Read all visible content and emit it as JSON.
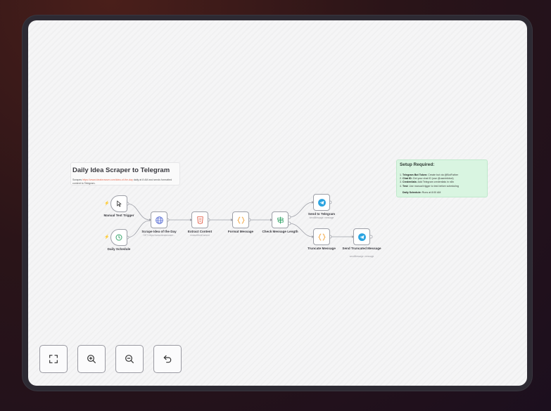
{
  "workflow": {
    "title_note": {
      "title": "Daily Idea Scraper to Telegram",
      "desc_prefix": "Scrapes",
      "desc_link": "https://www.ideabrowser.com/idea-of-the-day",
      "desc_suffix": "daily at 8 AM and sends formatted content to Telegram."
    },
    "setup_note": {
      "title": "Setup Required:",
      "items": [
        {
          "num": "1.",
          "bold": "Telegram Bot Token:",
          "text": "Create bot via @BotFather"
        },
        {
          "num": "2.",
          "bold": "Chat ID:",
          "text": "Get your chat ID (use @userinfobot)"
        },
        {
          "num": "3.",
          "bold": "Credentials:",
          "text": "Add Telegram credentials in n8n"
        },
        {
          "num": "4.",
          "bold": "Test:",
          "text": "Use manual trigger to test before scheduling"
        }
      ],
      "schedule_bold": "Daily Schedule:",
      "schedule_text": "Runs at 8:00 AM"
    },
    "nodes": {
      "manual": {
        "label": "Manual Test Trigger"
      },
      "daily": {
        "label": "Daily Schedule"
      },
      "scrape": {
        "label": "Scrape Idea of the Day",
        "sub": "GET: https://www.ideabrowser..."
      },
      "extract": {
        "label": "Extract Content",
        "sub": "extractHtmlContent"
      },
      "format": {
        "label": "Format Message"
      },
      "check": {
        "label": "Check Message Length"
      },
      "send": {
        "label": "Send to Telegram",
        "sub": "sendMessage: message"
      },
      "truncate": {
        "label": "Truncate Message"
      },
      "send_trunc": {
        "label": "Send Truncated Message",
        "sub": "sendMessage: message"
      }
    },
    "colors": {
      "accent": "#ee6b50",
      "telegram": "#2aa3e0",
      "code": "#f2a33a",
      "html": "#e2553f",
      "http": "#5a6fd6",
      "if": "#3aa76d",
      "sticky_green": "#d9f5e1"
    }
  },
  "controls": {
    "fit": {
      "icon": "fullscreen-icon"
    },
    "zoom_in": {
      "icon": "zoom-in-icon"
    },
    "zoom_out": {
      "icon": "zoom-out-icon"
    },
    "reset": {
      "icon": "undo-icon"
    }
  }
}
